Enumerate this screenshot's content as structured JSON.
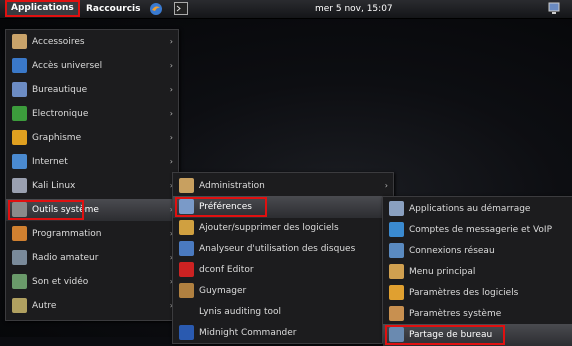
{
  "topbar": {
    "applications_label": "Applications",
    "raccourcis_label": "Raccourcis",
    "clock": "mer 5 nov, 15:07"
  },
  "menu_main": [
    {
      "label": "Accessoires",
      "icon": "accessories-icon",
      "color": "#c9a36a"
    },
    {
      "label": "Accès universel",
      "icon": "accessibility-icon",
      "color": "#3a78c8"
    },
    {
      "label": "Bureautique",
      "icon": "office-icon",
      "color": "#6c8cc4"
    },
    {
      "label": "Electronique",
      "icon": "electronics-icon",
      "color": "#3c9c3c"
    },
    {
      "label": "Graphisme",
      "icon": "graphics-icon",
      "color": "#e0a020"
    },
    {
      "label": "Internet",
      "icon": "globe-icon",
      "color": "#4a8ad0"
    },
    {
      "label": "Kali Linux",
      "icon": "kali-icon",
      "color": "#9aa0b0"
    },
    {
      "label": "Outils système",
      "icon": "system-tools-icon",
      "color": "#8a8a8a"
    },
    {
      "label": "Programmation",
      "icon": "programming-icon",
      "color": "#d08030"
    },
    {
      "label": "Radio amateur",
      "icon": "radio-icon",
      "color": "#7a8a9a"
    },
    {
      "label": "Son et vidéo",
      "icon": "multimedia-icon",
      "color": "#6a9a6a"
    },
    {
      "label": "Autre",
      "icon": "other-icon",
      "color": "#b0a060"
    }
  ],
  "menu_system": [
    {
      "label": "Administration",
      "icon": "administration-icon",
      "color": "#c8a060"
    },
    {
      "label": "Préférences",
      "icon": "preferences-icon",
      "color": "#7a9ac8"
    },
    {
      "label": "Ajouter/supprimer des logiciels",
      "icon": "package-icon",
      "color": "#d0a040"
    },
    {
      "label": "Analyseur d'utilisation des disques",
      "icon": "disk-usage-icon",
      "color": "#4a7ac0"
    },
    {
      "label": "dconf Editor",
      "icon": "dconf-icon",
      "color": "#cc2222"
    },
    {
      "label": "Guymager",
      "icon": "guymager-icon",
      "color": "#b08040"
    },
    {
      "label": "Lynis auditing tool",
      "icon": "",
      "color": "#1c1c1e"
    },
    {
      "label": "Midnight Commander",
      "icon": "midnight-commander-icon",
      "color": "#2a5ab0"
    }
  ],
  "menu_prefs": [
    {
      "label": "Applications au démarrage",
      "icon": "startup-apps-icon",
      "color": "#8aa0c0"
    },
    {
      "label": "Comptes de messagerie et VoIP",
      "icon": "chat-accounts-icon",
      "color": "#3a8ad0"
    },
    {
      "label": "Connexions réseau",
      "icon": "network-icon",
      "color": "#5a8ac0"
    },
    {
      "label": "Menu principal",
      "icon": "main-menu-icon",
      "color": "#d0a050"
    },
    {
      "label": "Paramètres des logiciels",
      "icon": "software-settings-icon",
      "color": "#e0a030"
    },
    {
      "label": "Paramètres système",
      "icon": "system-settings-icon",
      "color": "#c89050"
    },
    {
      "label": "Partage de bureau",
      "icon": "desktop-sharing-icon",
      "color": "#6a8ab0"
    }
  ],
  "colors": {
    "highlight": "#e01010"
  }
}
